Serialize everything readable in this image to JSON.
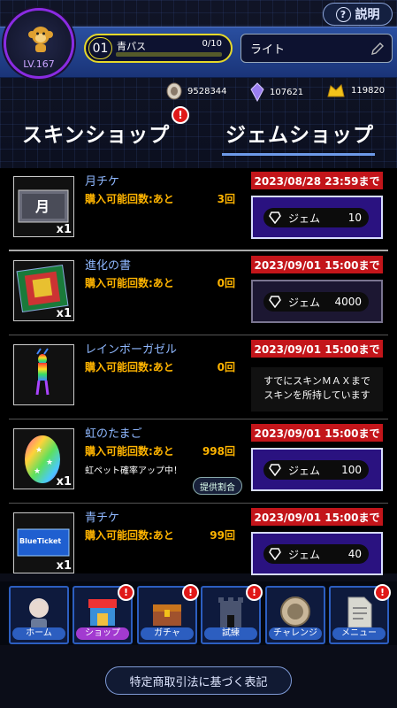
{
  "header": {
    "help_label": "説明",
    "level": "LV.167",
    "pass": {
      "number": "01",
      "name": "青パス",
      "progress": "0/10",
      "progress_fraction": 0.0
    },
    "title_field": "ライト"
  },
  "currencies": [
    {
      "icon": "coin-icon",
      "value": "9528344"
    },
    {
      "icon": "crystal-icon",
      "value": "107621"
    },
    {
      "icon": "gold-icon",
      "value": "119820"
    }
  ],
  "tabs": [
    {
      "label": "スキンショップ",
      "badge": "!",
      "active": false
    },
    {
      "label": "ジェムショップ",
      "active": true
    }
  ],
  "items": [
    {
      "name": "月チケ",
      "limit_label": "購入可能回数:あと",
      "remaining": "3回",
      "qty": "x1",
      "deadline": "2023/08/28 23:59まで",
      "currency": "ジェム",
      "price": "10",
      "thumb_text": "月"
    },
    {
      "name": "進化の書",
      "limit_label": "購入可能回数:あと",
      "remaining": "0回",
      "qty": "x1",
      "deadline": "2023/09/01 15:00まで",
      "currency": "ジェム",
      "price": "4000"
    },
    {
      "name": "レインボーガゼル",
      "limit_label": "購入可能回数:あと",
      "remaining": "0回",
      "deadline": "2023/09/01 15:00まで",
      "message_line1": "すでにスキンＭＡＸまで",
      "message_line2": "スキンを所持しています"
    },
    {
      "name": "虹のたまご",
      "limit_label": "購入可能回数:あと",
      "remaining": "998回",
      "note": "虹ペット確率アップ中！",
      "odds_label": "提供割合",
      "qty": "x1",
      "deadline": "2023/09/01 15:00まで",
      "currency": "ジェム",
      "price": "100"
    },
    {
      "name": "青チケ",
      "limit_label": "購入可能回数:あと",
      "remaining": "99回",
      "qty": "x1",
      "deadline": "2023/09/01 15:00まで",
      "currency": "ジェム",
      "price": "40",
      "thumb_text": "BlueTicket"
    }
  ],
  "nav": [
    {
      "label": "ホーム"
    },
    {
      "label": "ショップ",
      "badge": "!"
    },
    {
      "label": "ガチャ",
      "badge": "!"
    },
    {
      "label": "試練",
      "badge": "!"
    },
    {
      "label": "チャレンジ"
    },
    {
      "label": "メニュー",
      "badge": "!"
    }
  ],
  "footer": {
    "law_label": "特定商取引法に基づく表記"
  },
  "colors": {
    "accent": "#2c5ec0",
    "deadline": "#c3151a",
    "buy": "#2a1280",
    "limit": "#ffb400",
    "item_name": "#8fb8ff"
  }
}
